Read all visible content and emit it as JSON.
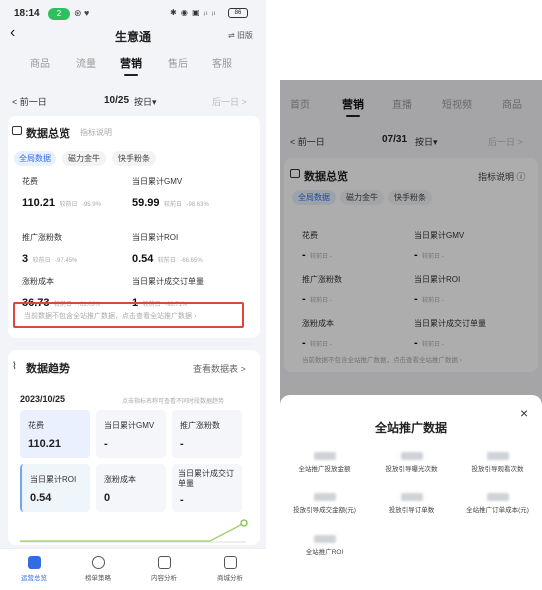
{
  "status": {
    "time": "18:14",
    "badge": "2"
  },
  "header": {
    "title": "生意通",
    "old_version": "旧版"
  },
  "main_tabs": [
    "商品",
    "流量",
    "营销",
    "售后",
    "客服"
  ],
  "left": {
    "date_prev": "< 前一日",
    "date": "10/25",
    "date_mode": "按日▾",
    "date_next": "后一日 >",
    "overview_title": "数据总览",
    "overview_link": "指标说明",
    "pills": [
      "全局数据",
      "磁力金牛",
      "快手粉条"
    ],
    "metrics": [
      {
        "label": "花费",
        "value": "110.21",
        "cmp": "较前日",
        "delta": "-95.9%"
      },
      {
        "label": "当日累计GMV",
        "value": "59.99",
        "cmp": "较前日",
        "delta": "-98.63%"
      },
      {
        "label": "推广涨粉数",
        "value": "3",
        "cmp": "较前日",
        "delta": "-97.45%"
      },
      {
        "label": "当日累计ROI",
        "value": "0.54",
        "cmp": "较前日",
        "delta": "-66.65%"
      },
      {
        "label": "涨粉成本",
        "value": "36.73",
        "cmp": "较前日",
        "delta": "+61.09%"
      },
      {
        "label": "当日累计成交订单量",
        "value": "1",
        "cmp": "较前日",
        "delta": "-98.71%"
      }
    ],
    "notice": "当前数据不包含全站推广数据，点击查看全站推广数据 ›",
    "trend_title": "数据趋势",
    "trend_link": "查看数据表 >",
    "trend_date": "2023/10/25",
    "trend_hint": "点击指标名称可查看不同时段数据趋势",
    "tiles": [
      {
        "label": "花费",
        "value": "110.21"
      },
      {
        "label": "当日累计GMV",
        "value": "-"
      },
      {
        "label": "推广涨粉数",
        "value": "-"
      },
      {
        "label": "当日累计ROI",
        "value": "0.54"
      },
      {
        "label": "涨粉成本",
        "value": "0"
      },
      {
        "label": "当日累计成交订单量",
        "value": "-"
      }
    ],
    "nav": [
      "运营总览",
      "榜单策略",
      "内容分析",
      "商城分析"
    ]
  },
  "right": {
    "tabs": [
      "首页",
      "营销",
      "直播",
      "短视频",
      "商品"
    ],
    "date_prev": "< 前一日",
    "date": "07/31",
    "date_mode": "按日▾",
    "date_next": "后一日 >",
    "overview_title": "数据总览",
    "overview_link": "指标说明 ⓘ",
    "pills": [
      "全局数据",
      "磁力金牛",
      "快手粉条"
    ],
    "metrics": [
      {
        "label": "花费",
        "value": "-",
        "cmp": "较前日 -"
      },
      {
        "label": "当日累计GMV",
        "value": "-",
        "cmp": "较前日 -"
      },
      {
        "label": "推广涨粉数",
        "value": "-",
        "cmp": "较前日 -"
      },
      {
        "label": "当日累计ROI",
        "value": "-",
        "cmp": "较前日 -"
      },
      {
        "label": "涨粉成本",
        "value": "-",
        "cmp": "较前日 -"
      },
      {
        "label": "当日累计成交订单量",
        "value": "-",
        "cmp": "较前日 -"
      }
    ],
    "notice": "当前数据不包含全站推广数据，点击查看全站推广数据 ›",
    "sheet_title": "全站推广数据",
    "close": "×",
    "sheet_items": [
      "全站推广投放金额",
      "投放引导曝光次数",
      "投放引导观看次数",
      "投放引导成交金额(元)",
      "投放引导订单数",
      "全站推广订单成本(元)",
      "全站推广ROI"
    ]
  }
}
